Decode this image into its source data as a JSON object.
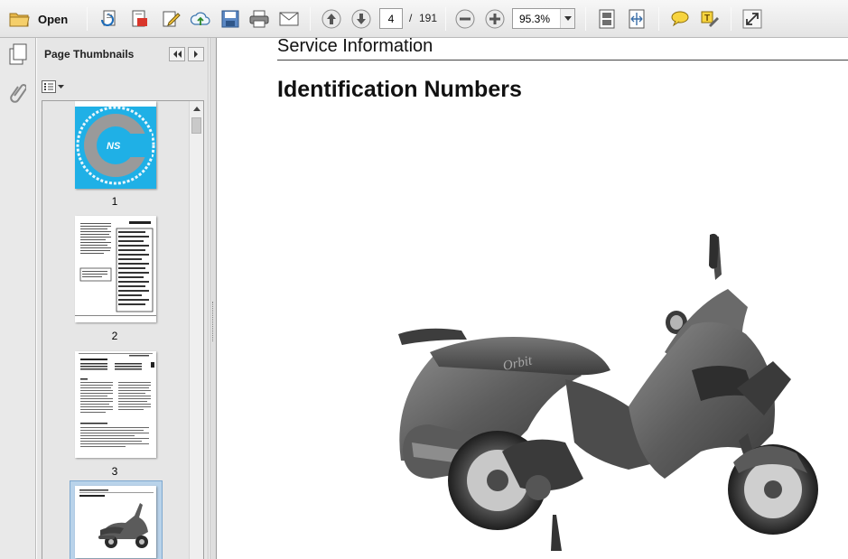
{
  "toolbar": {
    "open_label": "Open",
    "current_page": "4",
    "page_separator": "/",
    "total_pages": "191",
    "zoom": "95.3%"
  },
  "panel": {
    "title": "Page Thumbnails",
    "thumbnails": [
      {
        "label": "1"
      },
      {
        "label": "2"
      },
      {
        "label": "3"
      }
    ]
  },
  "document": {
    "header": "Service Information",
    "title": "Identification Numbers"
  },
  "colors": {
    "cover_blue": "#1fb0e6",
    "selection": "#b9d3ea"
  }
}
